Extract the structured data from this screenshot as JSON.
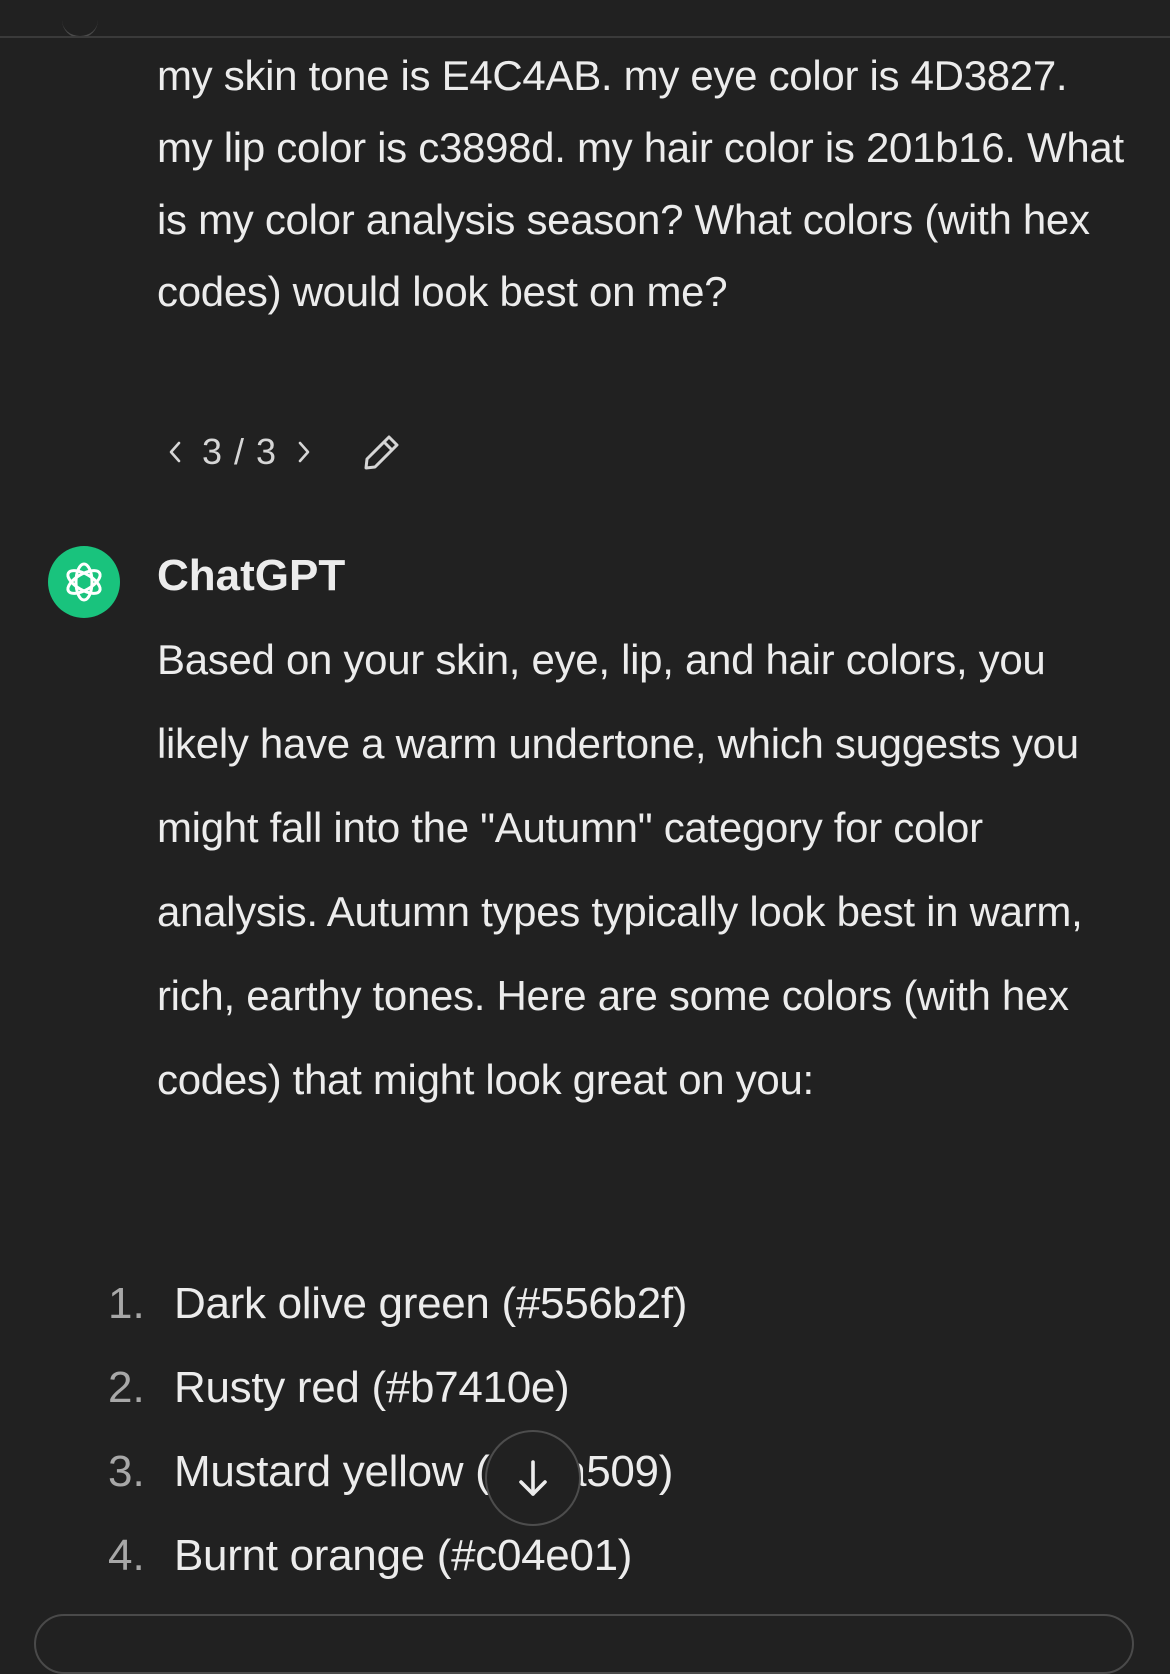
{
  "user_message": {
    "text": "my skin tone is E4C4AB. my eye color is 4D3827. my lip color is c3898d. my hair color is 201b16. What is my color analysis season? What colors (with hex codes) would look best on me?",
    "pager": "3 / 3",
    "icons": {
      "prev": "chevron-left-icon",
      "next": "chevron-right-icon",
      "edit": "pencil-icon"
    }
  },
  "assistant": {
    "name": "ChatGPT",
    "avatar_icon": "openai-logo-icon",
    "avatar_color": "#19c37d",
    "intro": "Based on your skin, eye, lip, and hair colors, you likely have a warm undertone, which suggests you might fall into the \"Autumn\" category for color analysis. Autumn types typically look best in warm, rich, earthy tones. Here are some colors (with hex codes) that might look great on you:",
    "list": [
      {
        "num": "1.",
        "text": "Dark olive green (#556b2f)"
      },
      {
        "num": "2.",
        "text": "Rusty red (#b7410e)"
      },
      {
        "num": "3.",
        "text": "Mustard yellow (#e4a509)"
      },
      {
        "num": "4.",
        "text": "Burnt orange (#c04e01)"
      }
    ]
  },
  "scroll_button": {
    "icon": "arrow-down-icon"
  },
  "theme": {
    "background": "#212121",
    "text": "#ececec"
  }
}
